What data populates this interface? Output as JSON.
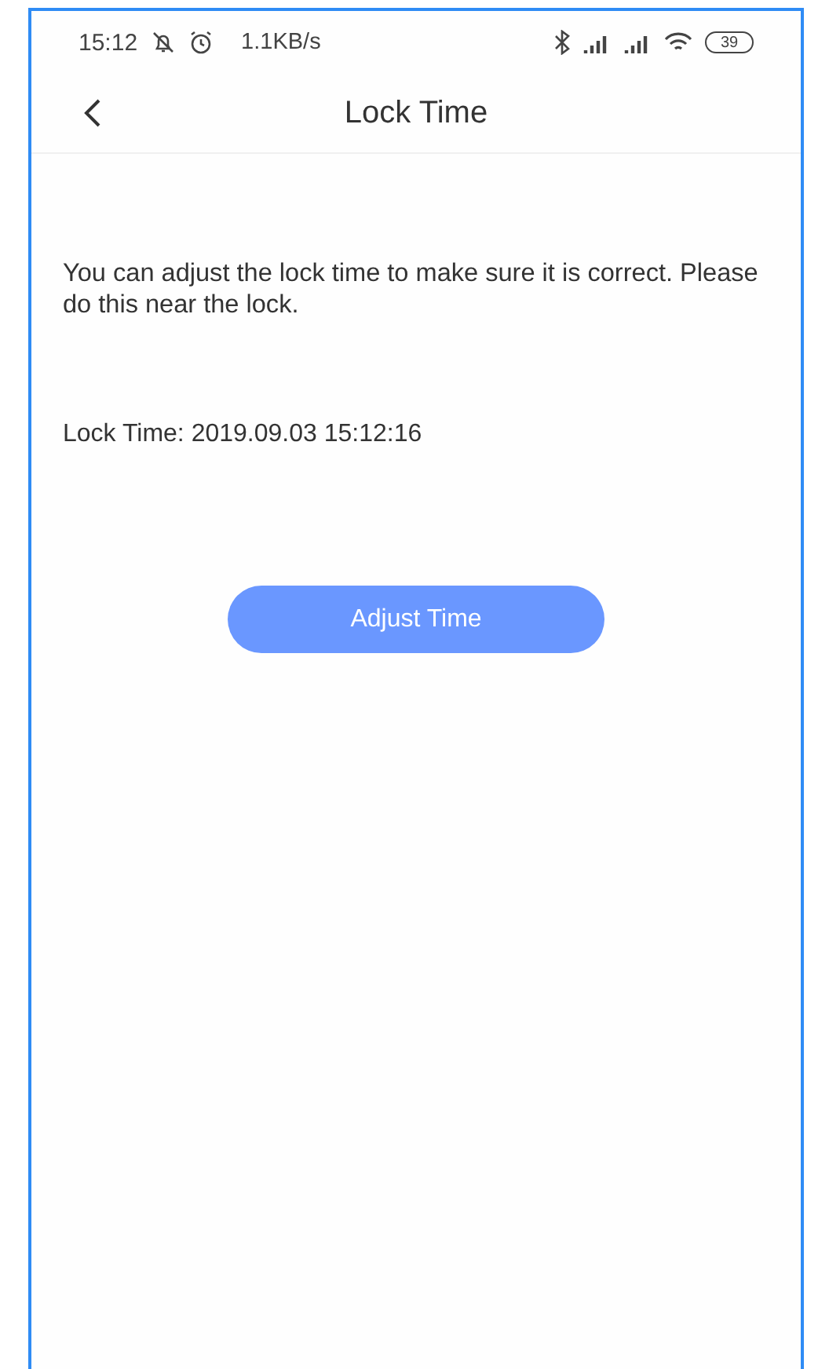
{
  "status_bar": {
    "time": "15:12",
    "speed": "1.1KB/s",
    "battery": "39"
  },
  "header": {
    "title": "Lock Time"
  },
  "description": "You can adjust the lock time to make sure it is correct. Please do this near the lock.",
  "lock_time": {
    "label": "Lock Time:",
    "value": "2019.09.03 15:12:16"
  },
  "button": {
    "label": "Adjust Time"
  }
}
